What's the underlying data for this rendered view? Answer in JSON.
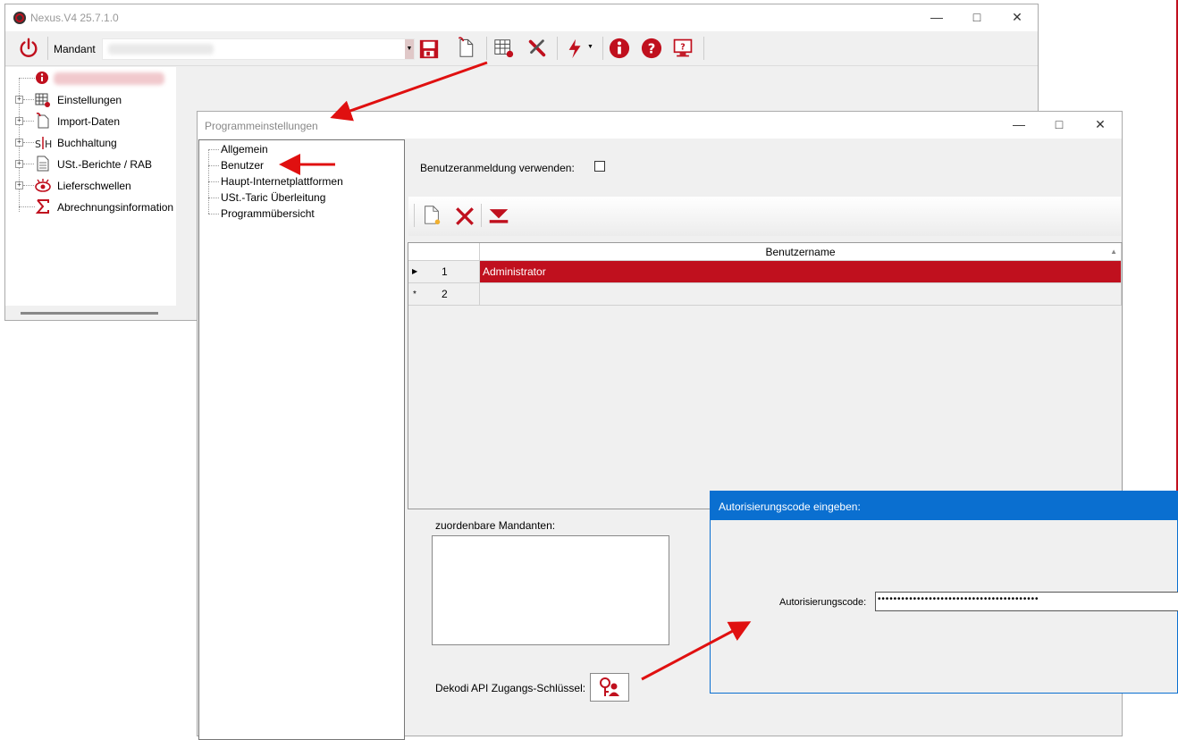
{
  "main_window": {
    "title": "Nexus.V4 25.7.1.0",
    "toolbar": {
      "mandant_label": "Mandant"
    },
    "tree": [
      {
        "label": "Einstellungen"
      },
      {
        "label": "Import-Daten"
      },
      {
        "label": "Buchhaltung"
      },
      {
        "label": "USt.-Berichte / RAB"
      },
      {
        "label": "Lieferschwellen"
      },
      {
        "label": "Abrechnungsinformation"
      }
    ]
  },
  "settings_window": {
    "title": "Programmeinstellungen",
    "nav": [
      {
        "label": "Allgemein"
      },
      {
        "label": "Benutzer"
      },
      {
        "label": "Haupt-Internetplattformen"
      },
      {
        "label": "USt.-Taric Überleitung"
      },
      {
        "label": "Programmübersicht"
      }
    ],
    "benutzer_anmeldung_label": "Benutzeranmeldung verwenden:",
    "grid": {
      "column_header": "Benutzername",
      "rows": [
        {
          "num": "1",
          "marker": "▶",
          "name": "Administrator"
        },
        {
          "num": "2",
          "marker": "*",
          "name": ""
        }
      ]
    },
    "mandanten_label": "zuordenbare Mandanten:",
    "api_key_label": "Dekodi API Zugangs-Schlüssel:"
  },
  "auth_dialog": {
    "title": "Autorisierungscode eingeben:",
    "code_label": "Autorisierungscode:",
    "code_value": "•••••••••••••••••••••••••••••••••••••••••"
  },
  "colors": {
    "accent_red": "#c0101e",
    "dialog_blue": "#0a6fd0"
  }
}
